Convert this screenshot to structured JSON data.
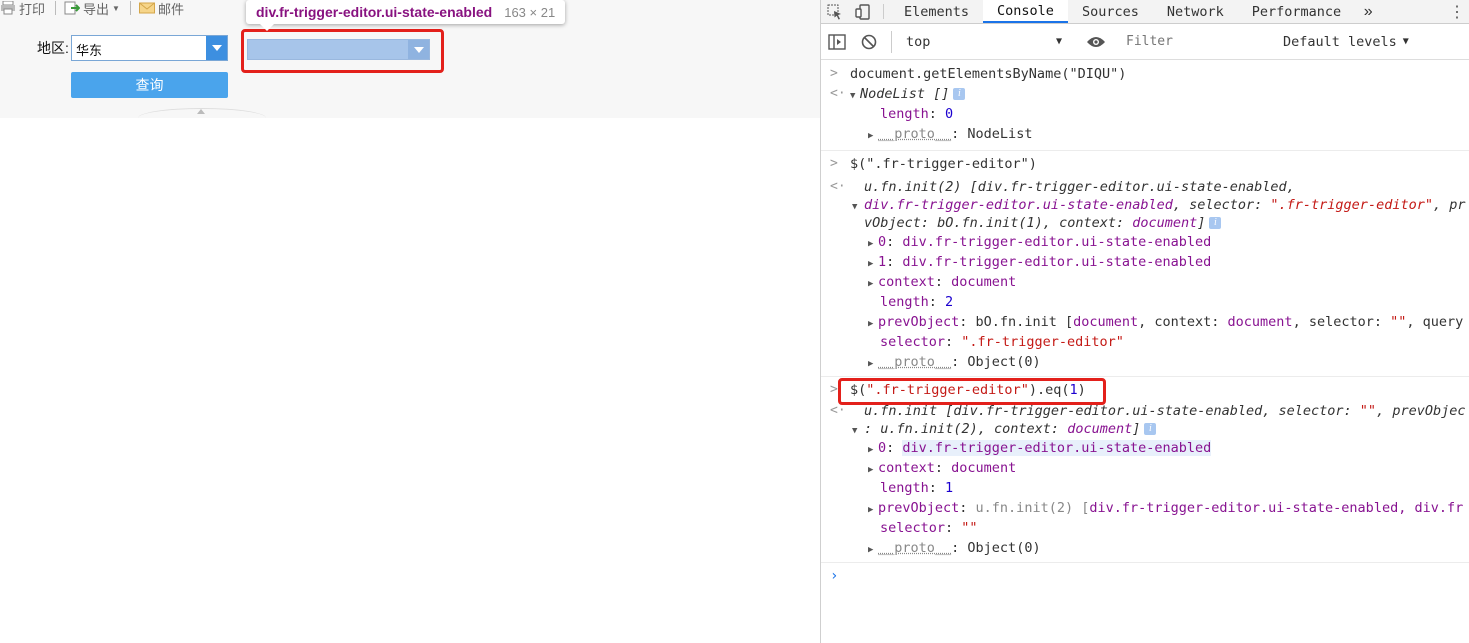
{
  "webpage": {
    "toolbar": {
      "print": "打印",
      "export": "导出",
      "mail": "邮件"
    },
    "form": {
      "area_label": "地区:",
      "area_value": "华东",
      "query_button": "查询"
    },
    "tooltip": {
      "tag": "div.fr-trigger-editor.ui-state-enabled",
      "dims": "163 × 21"
    }
  },
  "devtools": {
    "tabs": [
      "Elements",
      "Console",
      "Sources",
      "Network",
      "Performance"
    ],
    "active_tab": "Console",
    "more_tabs": "»",
    "toolbar": {
      "context": "top",
      "filter_placeholder": "Filter",
      "levels": "Default levels"
    },
    "console": {
      "cmd1": "document.getElementsByName(\"DIQU\")",
      "nodelist": "NodeList []",
      "length_key": "length",
      "length0": "0",
      "proto_key": "__proto__",
      "proto_nodelist": "NodeList",
      "cmd2": "$(\".fr-trigger-editor\")",
      "res2_line1": "u.fn.init(2) [div.fr-trigger-editor.ui-state-enabled,",
      "res2_line2a": "div.fr-trigger-editor.ui-state-enabled",
      "res2_line2b": ", selector: ",
      "res2_line2c": "\".fr-trigger-editor\"",
      "res2_line2d": ", pr",
      "res2_line3a": "vObject: bO.fn.init(1), context: ",
      "res2_line3b": "document",
      "res2_line3c": "]",
      "item0_key": "0",
      "item0_val": "div.fr-trigger-editor.ui-state-enabled",
      "item1_key": "1",
      "item1_val": "div.fr-trigger-editor.ui-state-enabled",
      "context_key": "context",
      "context_val": "document",
      "length2": "2",
      "prevobj_key": "prevObject",
      "prevobj2_a": "bO.fn.init [",
      "prevobj2_b": "document",
      "prevobj2_c": ", context: ",
      "prevobj2_d": "document",
      "prevobj2_e": ", selector: ",
      "prevobj2_f": "\"\"",
      "prevobj2_g": ", query",
      "selector_key": "selector",
      "selector2_val": "\".fr-trigger-editor\"",
      "proto_obj": "Object(0)",
      "cmd3_a": "$(",
      "cmd3_b": "\".fr-trigger-editor\"",
      "cmd3_c": ").eq(",
      "cmd3_d": "1",
      "cmd3_e": ")",
      "res3_line1a": "u.fn.init [div.fr-trigger-editor.ui-state-enabled, selector: ",
      "res3_line1b": "\"\"",
      "res3_line1c": ", prevObjec",
      "res3_line2a": ": u.fn.init(2), context: ",
      "res3_line2b": "document",
      "res3_line2c": "]",
      "length1": "1",
      "prevobj3_a": "u.fn.init(2) [",
      "prevobj3_b": "div.fr-trigger-editor.ui-state-enabled, div.fr",
      "selector3_val": "\"\""
    }
  }
}
